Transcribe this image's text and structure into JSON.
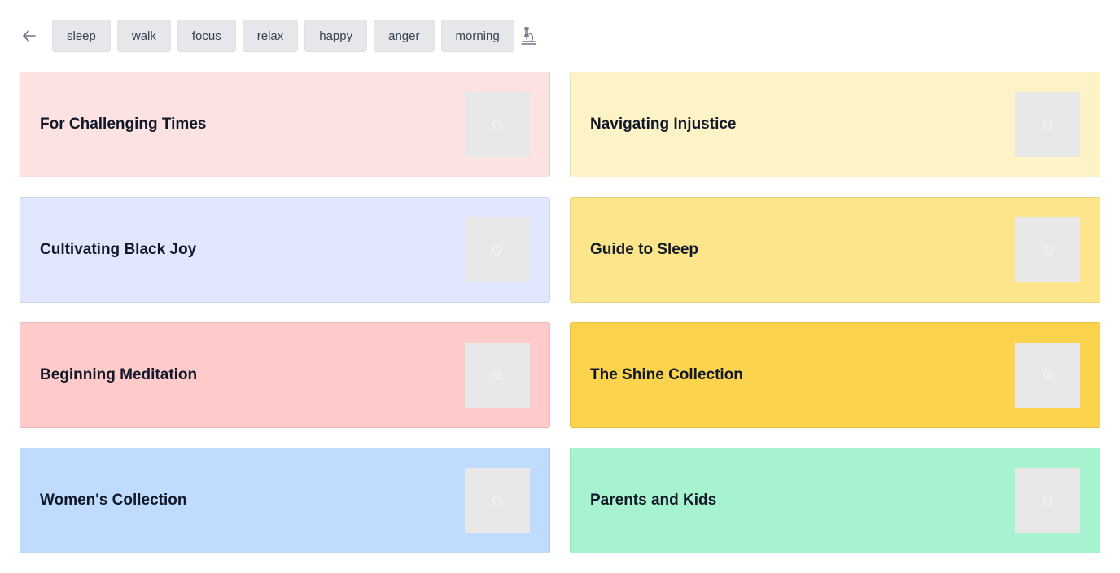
{
  "toolbar": {
    "back_icon": "arrow-left-icon",
    "lab_icon": "microscope-icon",
    "chips": [
      "sleep",
      "walk",
      "focus",
      "relax",
      "happy",
      "anger",
      "morning"
    ]
  },
  "cards": [
    {
      "title": "For Challenging Times",
      "color": "#fde2e2"
    },
    {
      "title": "Navigating Injustice",
      "color": "#fef3c7"
    },
    {
      "title": "Cultivating Black Joy",
      "color": "#e0e7ff"
    },
    {
      "title": "Guide to Sleep",
      "color": "#fce58b"
    },
    {
      "title": "Beginning Meditation",
      "color": "#fecaca"
    },
    {
      "title": "The Shine Collection",
      "color": "#fcd34d"
    },
    {
      "title": "Women's Collection",
      "color": "#bfdbfe"
    },
    {
      "title": "Parents and Kids",
      "color": "#a7f3d0"
    }
  ]
}
